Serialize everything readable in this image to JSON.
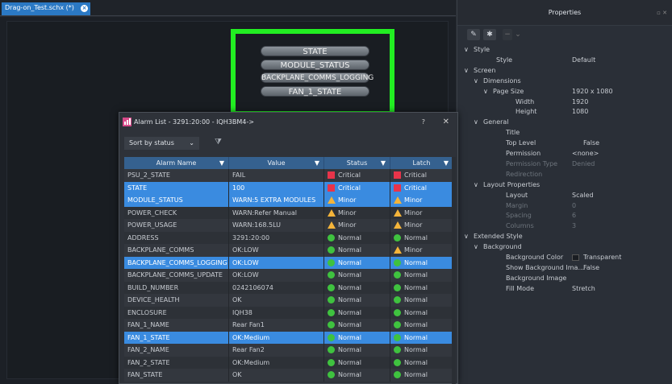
{
  "tab": {
    "label": "Drag-on_Test.schx (*)"
  },
  "canvas_labels": [
    "STATE",
    "MODULE_STATUS",
    "BACKPLANE_COMMS_LOGGING",
    "FAN_1_STATE"
  ],
  "properties": {
    "title": "Properties",
    "rows": [
      {
        "label": "Style",
        "value": "",
        "indent": 0,
        "arrow": "v",
        "dim": false
      },
      {
        "label": "Style",
        "value": "Default",
        "indent": 2,
        "arrow": "",
        "dim": false
      },
      {
        "label": "Screen",
        "value": "",
        "indent": 0,
        "arrow": "v",
        "dim": false
      },
      {
        "label": "Dimensions",
        "value": "",
        "indent": 1,
        "arrow": "v",
        "dim": false
      },
      {
        "label": "Page Size",
        "value": "1920 x 1080",
        "indent": 2,
        "arrow": "v",
        "dim": false
      },
      {
        "label": "Width",
        "value": "1920",
        "indent": 4,
        "arrow": "",
        "dim": false
      },
      {
        "label": "Height",
        "value": "1080",
        "indent": 4,
        "arrow": "",
        "dim": false
      },
      {
        "label": "General",
        "value": "",
        "indent": 1,
        "arrow": "v",
        "dim": false
      },
      {
        "label": "Title",
        "value": "",
        "indent": 3,
        "arrow": "",
        "dim": false
      },
      {
        "label": "Top Level",
        "value": "False",
        "indent": 3,
        "arrow": "",
        "dim": false
      },
      {
        "label": "Permission",
        "value": "<none>",
        "indent": 3,
        "arrow": "",
        "dim": false
      },
      {
        "label": "Permission Type",
        "value": "Denied",
        "indent": 3,
        "arrow": "",
        "dim": true
      },
      {
        "label": "Redirection",
        "value": "",
        "indent": 3,
        "arrow": "",
        "dim": true
      },
      {
        "label": "Layout Properties",
        "value": "",
        "indent": 1,
        "arrow": "v",
        "dim": false
      },
      {
        "label": "Layout",
        "value": "Scaled",
        "indent": 3,
        "arrow": "",
        "dim": false
      },
      {
        "label": "Margin",
        "value": "0",
        "indent": 3,
        "arrow": "",
        "dim": true
      },
      {
        "label": "Spacing",
        "value": "6",
        "indent": 3,
        "arrow": "",
        "dim": true
      },
      {
        "label": "Columns",
        "value": "3",
        "indent": 3,
        "arrow": "",
        "dim": true
      },
      {
        "label": "Extended Style",
        "value": "",
        "indent": 0,
        "arrow": "v",
        "dim": false
      },
      {
        "label": "Background",
        "value": "",
        "indent": 1,
        "arrow": "v",
        "dim": false
      },
      {
        "label": "Background Color",
        "value": "Transparent",
        "indent": 3,
        "arrow": "",
        "dim": false
      },
      {
        "label": "Show Background Ima...",
        "value": "False",
        "indent": 3,
        "arrow": "",
        "dim": false
      },
      {
        "label": "Background Image",
        "value": "",
        "indent": 3,
        "arrow": "",
        "dim": false
      },
      {
        "label": "Fill Mode",
        "value": "Stretch",
        "indent": 3,
        "arrow": "",
        "dim": false
      }
    ]
  },
  "dialog": {
    "title": "Alarm List - 3291:20:00 - IQH3BM4->",
    "help": "?",
    "close": "✕",
    "sort": "Sort by status",
    "columns": [
      "Alarm Name",
      "Value",
      "Status",
      "Latch"
    ],
    "rows": [
      {
        "name": "PSU_2_STATE",
        "value": "FAIL",
        "status": "Critical",
        "latch": "Critical",
        "sel": false
      },
      {
        "name": "STATE",
        "value": "100",
        "status": "Critical",
        "latch": "Critical",
        "sel": true
      },
      {
        "name": "MODULE_STATUS",
        "value": "WARN:5 EXTRA MODULES",
        "status": "Minor",
        "latch": "Minor",
        "sel": true
      },
      {
        "name": "POWER_CHECK",
        "value": "WARN:Refer Manual",
        "status": "Minor",
        "latch": "Minor",
        "sel": false
      },
      {
        "name": "POWER_USAGE",
        "value": "WARN:168.5LU",
        "status": "Minor",
        "latch": "Minor",
        "sel": false
      },
      {
        "name": "ADDRESS",
        "value": "3291:20:00",
        "status": "Normal",
        "latch": "Normal",
        "sel": false
      },
      {
        "name": "BACKPLANE_COMMS",
        "value": "OK:LOW",
        "status": "Normal",
        "latch": "Minor",
        "sel": false
      },
      {
        "name": "BACKPLANE_COMMS_LOGGING",
        "value": "OK:LOW",
        "status": "Normal",
        "latch": "Normal",
        "sel": true
      },
      {
        "name": "BACKPLANE_COMMS_UPDATE",
        "value": "OK:LOW",
        "status": "Normal",
        "latch": "Normal",
        "sel": false
      },
      {
        "name": "BUILD_NUMBER",
        "value": "0242106074",
        "status": "Normal",
        "latch": "Normal",
        "sel": false
      },
      {
        "name": "DEVICE_HEALTH",
        "value": "OK",
        "status": "Normal",
        "latch": "Normal",
        "sel": false
      },
      {
        "name": "ENCLOSURE",
        "value": "IQH38",
        "status": "Normal",
        "latch": "Normal",
        "sel": false
      },
      {
        "name": "FAN_1_NAME",
        "value": "Rear Fan1",
        "status": "Normal",
        "latch": "Normal",
        "sel": false
      },
      {
        "name": "FAN_1_STATE",
        "value": "OK:Medium",
        "status": "Normal",
        "latch": "Normal",
        "sel": true
      },
      {
        "name": "FAN_2_NAME",
        "value": "Rear Fan2",
        "status": "Normal",
        "latch": "Normal",
        "sel": false
      },
      {
        "name": "FAN_2_STATE",
        "value": "OK:Medium",
        "status": "Normal",
        "latch": "Normal",
        "sel": false
      },
      {
        "name": "FAN_STATE",
        "value": "OK",
        "status": "Normal",
        "latch": "Normal",
        "sel": false
      }
    ]
  },
  "colors": {
    "accent": "#3a8be0",
    "critical": "#e8344a",
    "minor": "#f4b43a",
    "normal": "#3fc23f",
    "highlight": "#22ee22"
  }
}
